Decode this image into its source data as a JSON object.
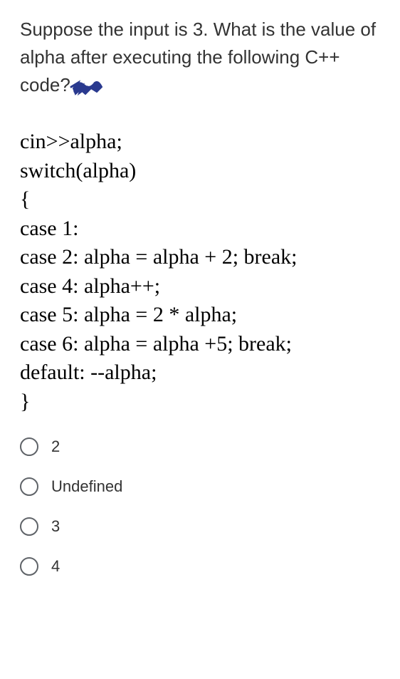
{
  "question": {
    "text": "Suppose the input is 3. What is the value of alpha after executing the following C++ code?"
  },
  "code": {
    "lines": [
      "cin>>alpha;",
      "switch(alpha)",
      "{",
      "case 1:",
      "case 2: alpha = alpha + 2; break;",
      "case 4: alpha++;",
      "case 5: alpha = 2 * alpha;",
      "case 6: alpha = alpha +5; break;",
      "default: --alpha;",
      "}"
    ]
  },
  "options": [
    {
      "label": "2"
    },
    {
      "label": "Undefined"
    },
    {
      "label": "3"
    },
    {
      "label": "4"
    }
  ]
}
